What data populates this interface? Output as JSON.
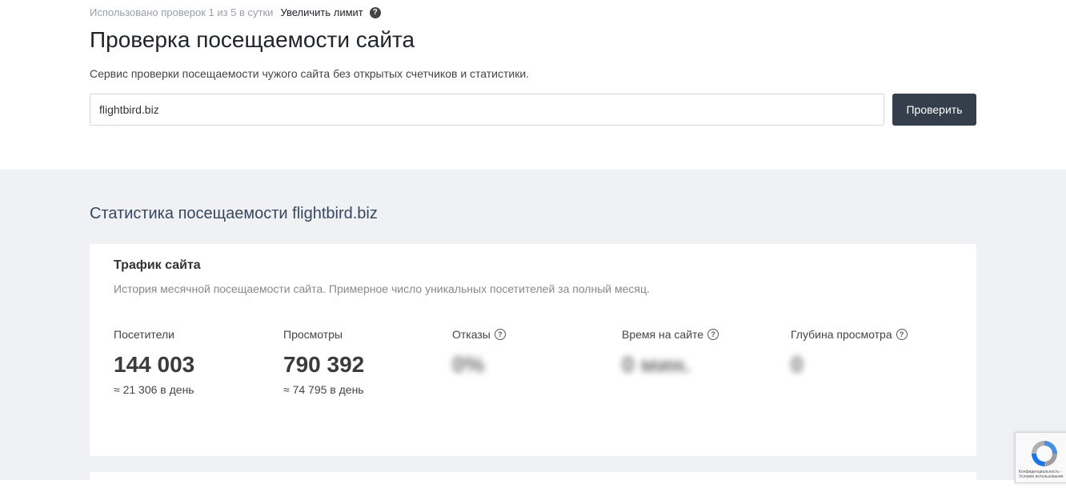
{
  "limit_bar": {
    "usage_text": "Использовано проверок 1 из 5 в сутки",
    "increase_link": "Увеличить лимит",
    "help_glyph": "?"
  },
  "header": {
    "title": "Проверка посещаемости сайта",
    "description": "Сервис проверки посещаемости чужого сайта без открытых счетчиков и статистики."
  },
  "search": {
    "value": "flightbird.biz",
    "button_label": "Проверить"
  },
  "stats": {
    "heading": "Статистика посещаемости flightbird.biz",
    "traffic_card": {
      "title": "Трафик сайта",
      "description": "История месячной посещаемости сайта. Примерное число уникальных посетителей за полный месяц.",
      "metrics": [
        {
          "label": "Посетители",
          "value": "144 003",
          "sub": "≈ 21 306 в день",
          "has_help": false,
          "blurred": false
        },
        {
          "label": "Просмотры",
          "value": "790 392",
          "sub": "≈ 74 795 в день",
          "has_help": false,
          "blurred": false
        },
        {
          "label": "Отказы",
          "value": "0%",
          "sub": "",
          "has_help": true,
          "blurred": true
        },
        {
          "label": "Время на сайте",
          "value": "0 мин.",
          "sub": "",
          "has_help": true,
          "blurred": true
        },
        {
          "label": "Глубина просмотра",
          "value": "0",
          "sub": "",
          "has_help": true,
          "blurred": true
        }
      ]
    }
  },
  "recaptcha": {
    "line1": "Конфиденциальность -",
    "line2": "Условия использования",
    "icon": "recaptcha-icon"
  },
  "colors": {
    "button_bg": "#343f4b",
    "stats_bg": "#eff1f5",
    "heading": "#37475d"
  }
}
